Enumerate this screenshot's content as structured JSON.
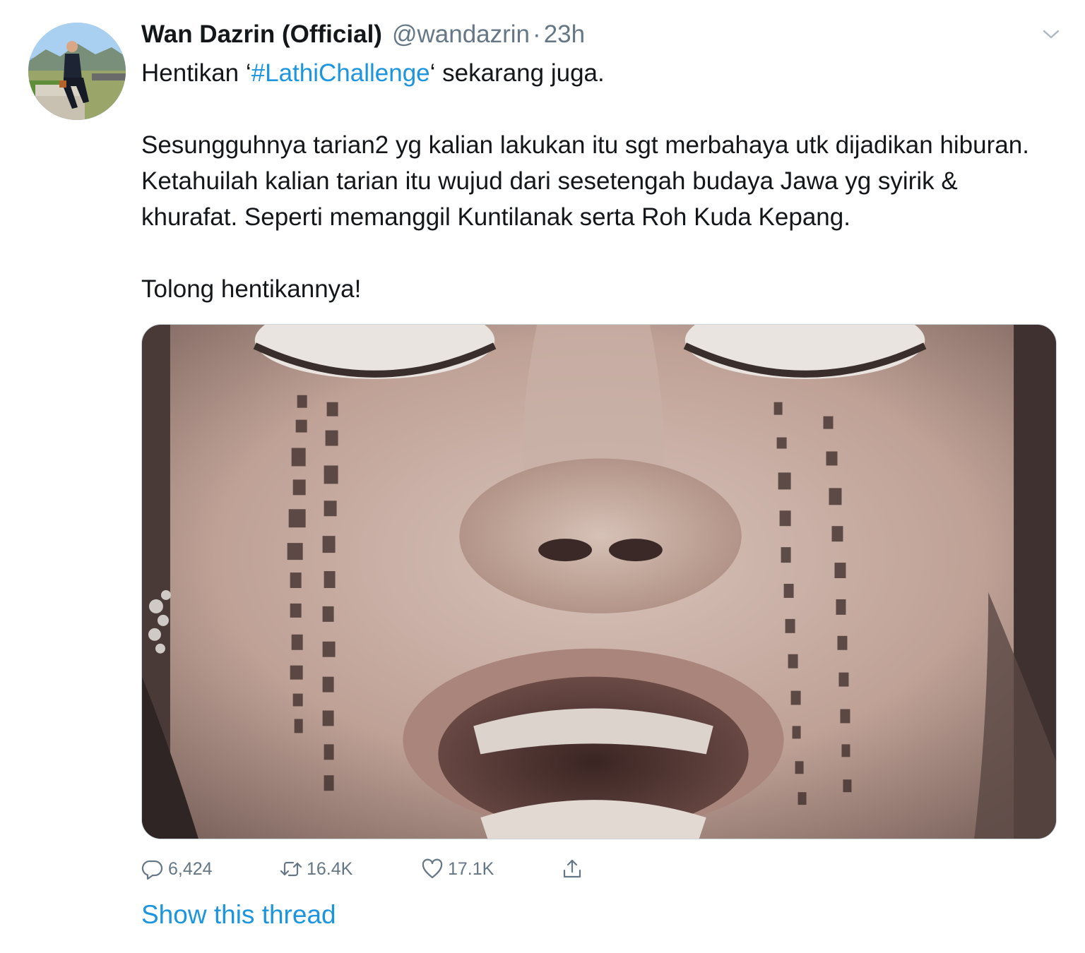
{
  "tweet": {
    "author_name": "Wan Dazrin (Official)",
    "author_handle": "@wandazrin",
    "separator": "·",
    "time": "23h",
    "text": {
      "line1_before": "Hentikan ‘",
      "hashtag": "#LathiChallenge",
      "line1_after": "‘ sekarang juga.",
      "paragraph2": "Sesungguhnya tarian2 yg kalian lakukan itu sgt merbahaya utk dijadikan hiburan. Ketahuilah kalian tarian itu wujud dari sesetengah budaya Jawa yg syirik & khurafat. Seperti memanggil Kuntilanak serta Roh Kuda Kepang.",
      "paragraph3": "Tolong hentikannya!"
    },
    "media": {
      "description_icon": "face-photo"
    },
    "stats": {
      "replies": "6,424",
      "retweets": "16.4K",
      "likes": "17.1K"
    },
    "show_thread": "Show this thread"
  },
  "icons": {
    "reply": "reply-icon",
    "retweet": "retweet-icon",
    "like": "heart-icon",
    "share": "share-icon",
    "more": "chevron-down-icon"
  },
  "colors": {
    "link": "#1b95e0",
    "secondary_text": "#657786",
    "primary_text": "#14171a",
    "border": "#ccd6dd"
  }
}
